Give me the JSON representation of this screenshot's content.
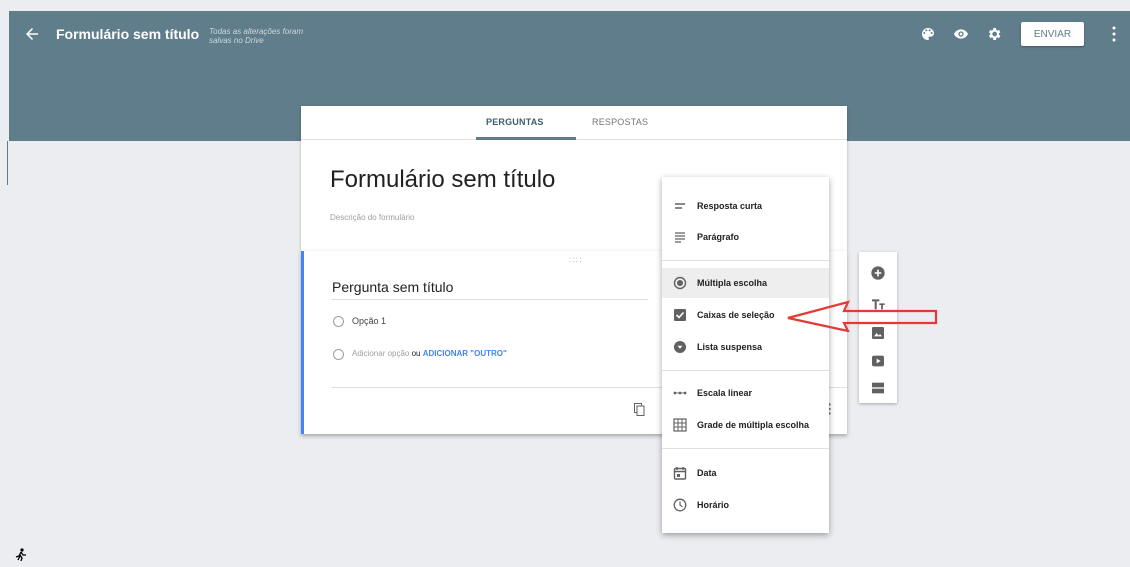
{
  "toolbar": {
    "title": "Formulário sem título",
    "saved_status": "Todas as alterações foram salvas no Drive",
    "send_label": "ENVIAR"
  },
  "tabs": [
    {
      "label": "PERGUNTAS",
      "active": true
    },
    {
      "label": "RESPOSTAS",
      "active": false
    }
  ],
  "form": {
    "title": "Formulário sem título",
    "description_placeholder": "Descrição do formulário"
  },
  "question": {
    "title": "Pergunta sem título",
    "option1": "Opção 1",
    "add_option": "Adicionar opção",
    "or": "ou",
    "add_other": "ADICIONAR \"OUTRO\""
  },
  "menu": {
    "items": [
      {
        "label": "Resposta curta",
        "icon": "short-text-icon"
      },
      {
        "label": "Parágrafo",
        "icon": "paragraph-icon"
      },
      {
        "label": "Múltipla escolha",
        "icon": "radio-button-icon",
        "selected": true
      },
      {
        "label": "Caixas de seleção",
        "icon": "checkbox-icon"
      },
      {
        "label": "Lista suspensa",
        "icon": "dropdown-icon"
      },
      {
        "label": "Escala linear",
        "icon": "linear-scale-icon"
      },
      {
        "label": "Grade de múltipla escolha",
        "icon": "grid-icon"
      },
      {
        "label": "Data",
        "icon": "calendar-icon"
      },
      {
        "label": "Horário",
        "icon": "clock-icon"
      }
    ]
  },
  "colors": {
    "header": "#607d8b",
    "accent": "#4285f4",
    "arrow": "#e53935"
  }
}
